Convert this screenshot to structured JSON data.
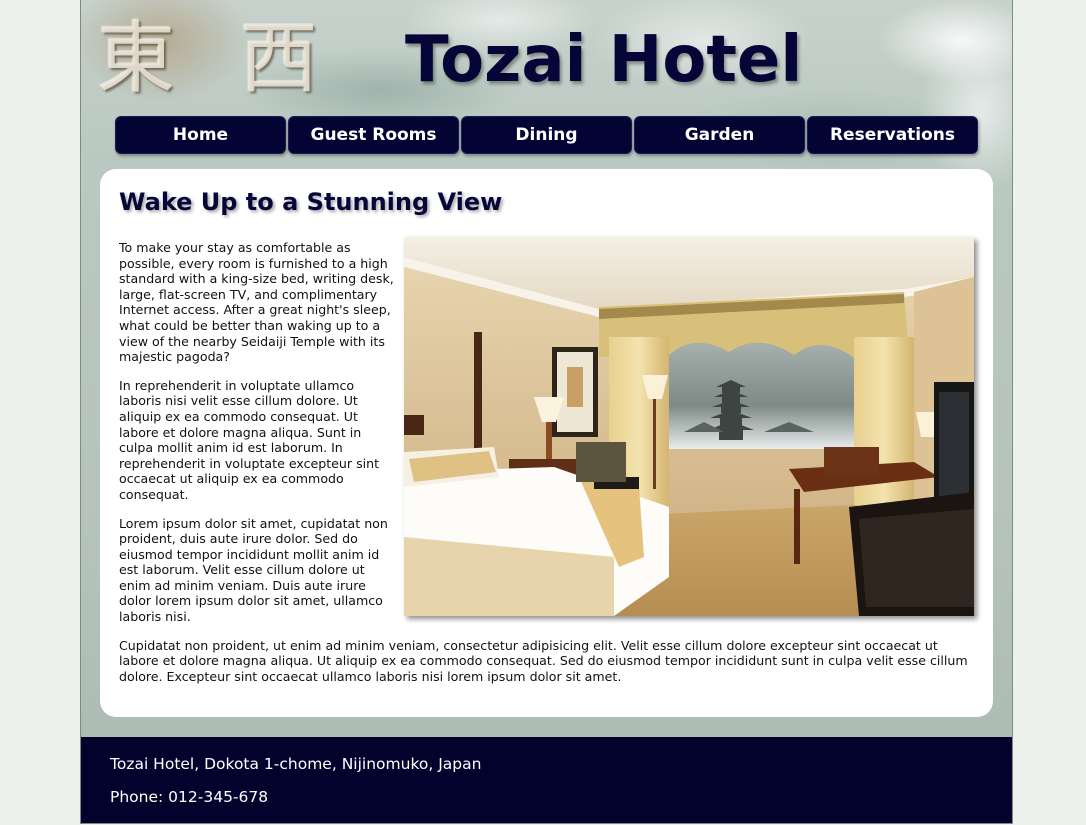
{
  "header": {
    "title": "Tozai Hotel",
    "kanji": "東 西"
  },
  "nav": {
    "items": [
      {
        "label": "Home"
      },
      {
        "label": "Guest Rooms"
      },
      {
        "label": "Dining"
      },
      {
        "label": "Garden"
      },
      {
        "label": "Reservations"
      }
    ]
  },
  "main": {
    "heading": "Wake Up to a Stunning View",
    "image_subject": "hotel-room-photo",
    "paragraphs": [
      "To make your stay as comfortable as possible, every room is furnished to a high standard with a king-size bed, writing desk, large, flat-screen TV, and complimentary Internet access. After a great night's sleep, what could be better than waking up to a view of the nearby Seidaiji Temple with its majestic pagoda?",
      "In reprehenderit in voluptate ullamco laboris nisi velit esse cillum dolore. Ut aliquip ex ea commodo consequat. Ut labore et dolore magna aliqua. Sunt in culpa mollit anim id est laborum. In reprehenderit in voluptate excepteur sint occaecat ut aliquip ex ea commodo consequat.",
      "Lorem ipsum dolor sit amet, cupidatat non proident, duis aute irure dolor. Sed do eiusmod tempor incididunt mollit anim id est laborum. Velit esse cillum dolore ut enim ad minim veniam. Duis aute irure dolor lorem ipsum dolor sit amet, ullamco laboris nisi.",
      "Cupidatat non proident, ut enim ad minim veniam, consectetur adipisicing elit. Velit esse cillum dolore excepteur sint occaecat ut labore et dolore magna aliqua. Ut aliquip ex ea commodo consequat. Sed do eiusmod tempor incididunt sunt in culpa velit esse cillum dolore. Excepteur sint occaecat ullamco laboris nisi lorem ipsum dolor sit amet."
    ]
  },
  "footer": {
    "address": "Tozai Hotel, Dokota 1-chome, Nijinomuko, Japan",
    "phone": "Phone: 012-345-678"
  },
  "colors": {
    "navy": "#040434",
    "footer_bg": "#02022d",
    "page_bg": "#edf1ee"
  }
}
